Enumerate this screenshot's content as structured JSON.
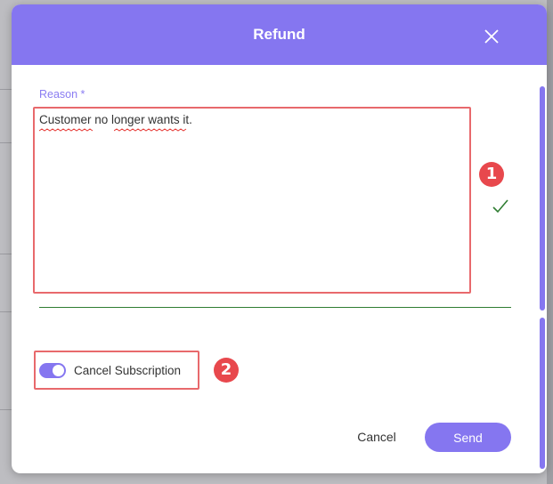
{
  "modal": {
    "title": "Refund",
    "close_icon": "close-icon"
  },
  "reason": {
    "label": "Reason *",
    "value": "Customer no longer wants it."
  },
  "markers": {
    "one": "1",
    "two": "2"
  },
  "subscription": {
    "label": "Cancel Subscription",
    "enabled": true
  },
  "actions": {
    "cancel_label": "Cancel",
    "send_label": "Send"
  },
  "colors": {
    "accent": "#8576f0",
    "highlight": "#e8696c",
    "marker": "#e8484d",
    "valid": "#2f7d32"
  }
}
